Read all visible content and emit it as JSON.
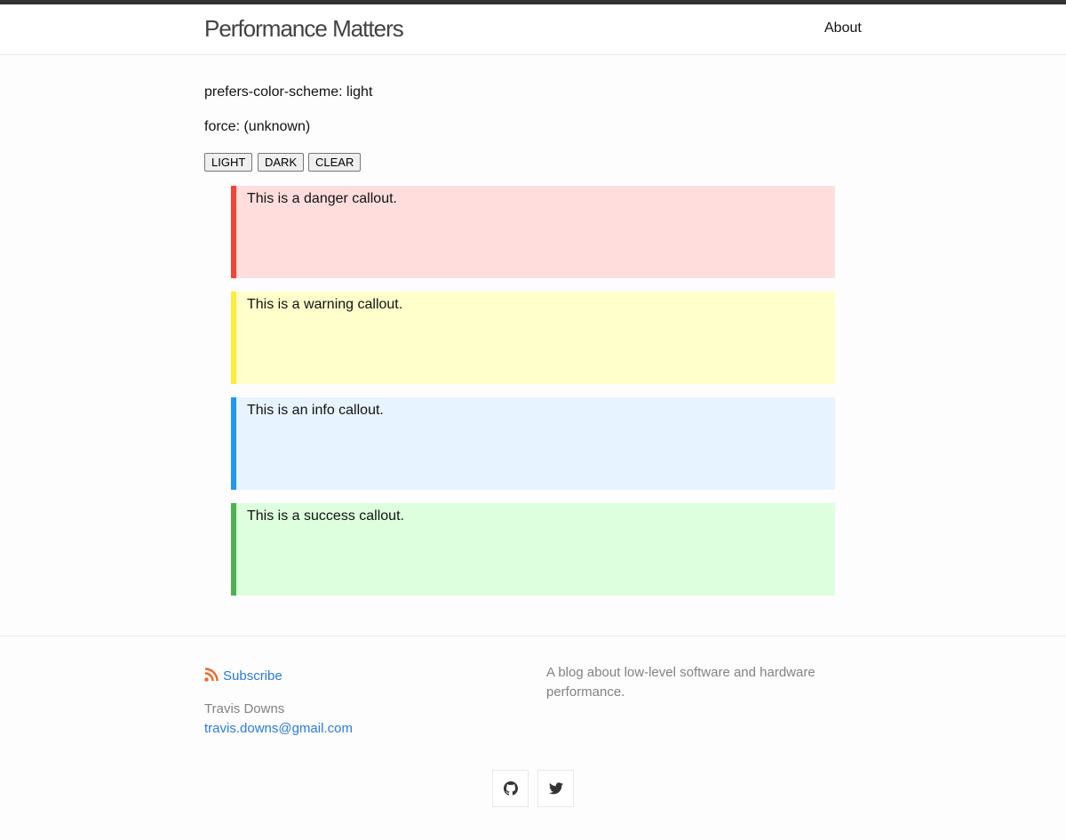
{
  "header": {
    "site_title": "Performance Matters",
    "nav": [
      {
        "label": "About"
      }
    ]
  },
  "main": {
    "color_scheme_line": "prefers-color-scheme: light",
    "force_line": "force: (unknown)",
    "buttons": {
      "light": "LIGHT",
      "dark": "DARK",
      "clear": "CLEAR"
    },
    "callouts": [
      {
        "kind": "danger",
        "text": "This is a danger callout.",
        "border_color": "#f44336",
        "bg_color": "#ffdddd"
      },
      {
        "kind": "warning",
        "text": "This is a warning callout.",
        "border_color": "#ffeb3b",
        "bg_color": "#ffffcc"
      },
      {
        "kind": "info",
        "text": "This is an info callout.",
        "border_color": "#2196f3",
        "bg_color": "#e7f3fe"
      },
      {
        "kind": "success",
        "text": "This is a success callout.",
        "border_color": "#4caf50",
        "bg_color": "#ddffdd"
      }
    ]
  },
  "footer": {
    "subscribe_label": "Subscribe",
    "author_name": "Travis Downs",
    "email": "travis.downs@gmail.com",
    "description": "A blog about low-level software and hardware performance.",
    "social": [
      {
        "icon": "github-icon"
      },
      {
        "icon": "twitter-icon"
      }
    ],
    "rss_color": "#f26522",
    "link_color": "#2a7ae2"
  }
}
